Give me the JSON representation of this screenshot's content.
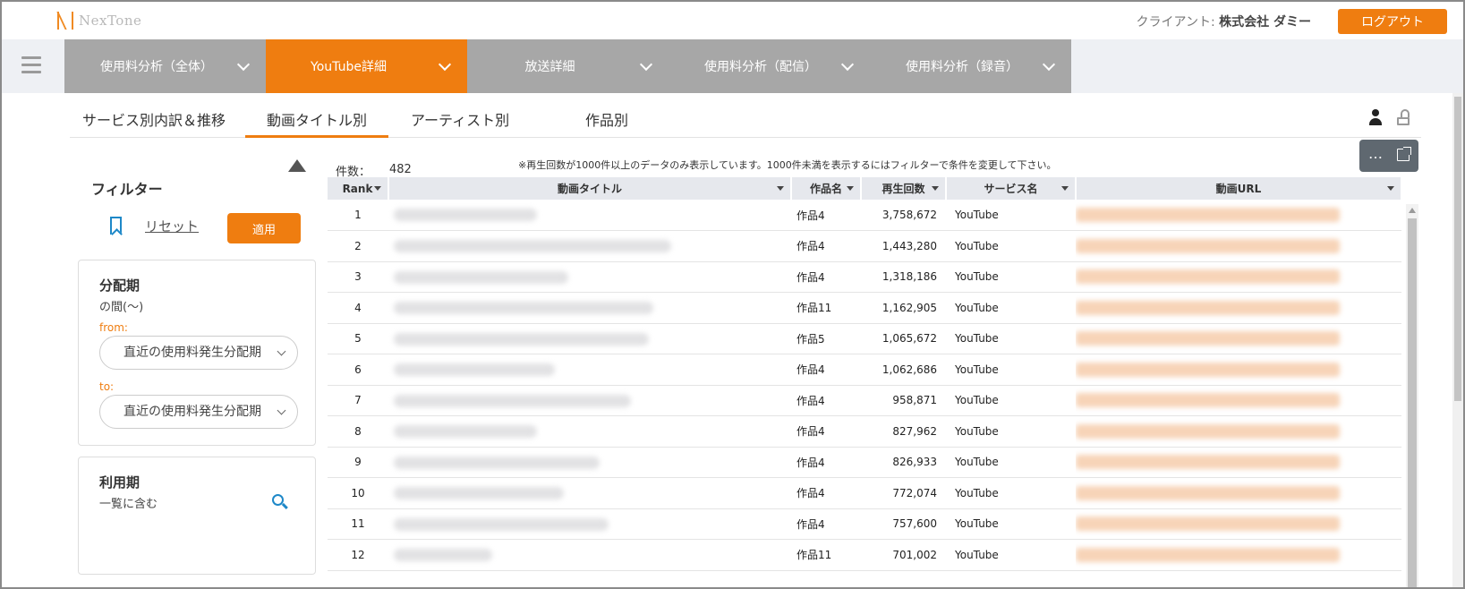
{
  "header": {
    "logo_text": "NexTone",
    "client_label": "クライアント: ",
    "client_name": "株式会社 ダミー",
    "logout_label": "ログアウト"
  },
  "nav": {
    "tabs": [
      {
        "label": "使用料分析（全体）",
        "active": false
      },
      {
        "label": "YouTube詳細",
        "active": true
      },
      {
        "label": "放送詳細",
        "active": false
      },
      {
        "label": "使用料分析（配信）",
        "active": false
      },
      {
        "label": "使用料分析（録音）",
        "active": false
      }
    ]
  },
  "subtabs": [
    {
      "label": "サービス別内訳＆推移",
      "active": false
    },
    {
      "label": "動画タイトル別",
      "active": true
    },
    {
      "label": "アーティスト別",
      "active": false
    },
    {
      "label": "作品別",
      "active": false
    }
  ],
  "filter": {
    "title": "フィルター",
    "reset_label": "リセット",
    "apply_label": "適用",
    "distribution": {
      "title": "分配期",
      "condition": "の間(〜)",
      "from_label": "from:",
      "from_value": "直近の使用料発生分配期",
      "to_label": "to:",
      "to_value": "直近の使用料発生分配期"
    },
    "usage": {
      "title": "利用期",
      "condition": "一覧に含む"
    }
  },
  "table": {
    "count_label": "件数：",
    "count_value": "482",
    "notice": "※再生回数が1000件以上のデータのみ表示しています。1000件未満を表示するにはフィルターで条件を変更して下さい。",
    "toolbox_dots": "…",
    "columns": [
      "Rank",
      "動画タイトル",
      "作品名",
      "再生回数",
      "サービス名",
      "動画URL"
    ],
    "rows": [
      {
        "rank": "1",
        "work": "作品4",
        "plays": "3,758,672",
        "service": "YouTube"
      },
      {
        "rank": "2",
        "work": "作品4",
        "plays": "1,443,280",
        "service": "YouTube"
      },
      {
        "rank": "3",
        "work": "作品4",
        "plays": "1,318,186",
        "service": "YouTube"
      },
      {
        "rank": "4",
        "work": "作品11",
        "plays": "1,162,905",
        "service": "YouTube"
      },
      {
        "rank": "5",
        "work": "作品5",
        "plays": "1,065,672",
        "service": "YouTube"
      },
      {
        "rank": "6",
        "work": "作品4",
        "plays": "1,062,686",
        "service": "YouTube"
      },
      {
        "rank": "7",
        "work": "作品4",
        "plays": "958,871",
        "service": "YouTube"
      },
      {
        "rank": "8",
        "work": "作品4",
        "plays": "827,962",
        "service": "YouTube"
      },
      {
        "rank": "9",
        "work": "作品4",
        "plays": "826,933",
        "service": "YouTube"
      },
      {
        "rank": "10",
        "work": "作品4",
        "plays": "772,074",
        "service": "YouTube"
      },
      {
        "rank": "11",
        "work": "作品4",
        "plays": "757,600",
        "service": "YouTube"
      },
      {
        "rank": "12",
        "work": "作品11",
        "plays": "701,002",
        "service": "YouTube"
      }
    ]
  },
  "colors": {
    "accent": "#ef7d10",
    "nav_inactive": "#a7a7a7",
    "link_blue": "#1e88c8"
  }
}
